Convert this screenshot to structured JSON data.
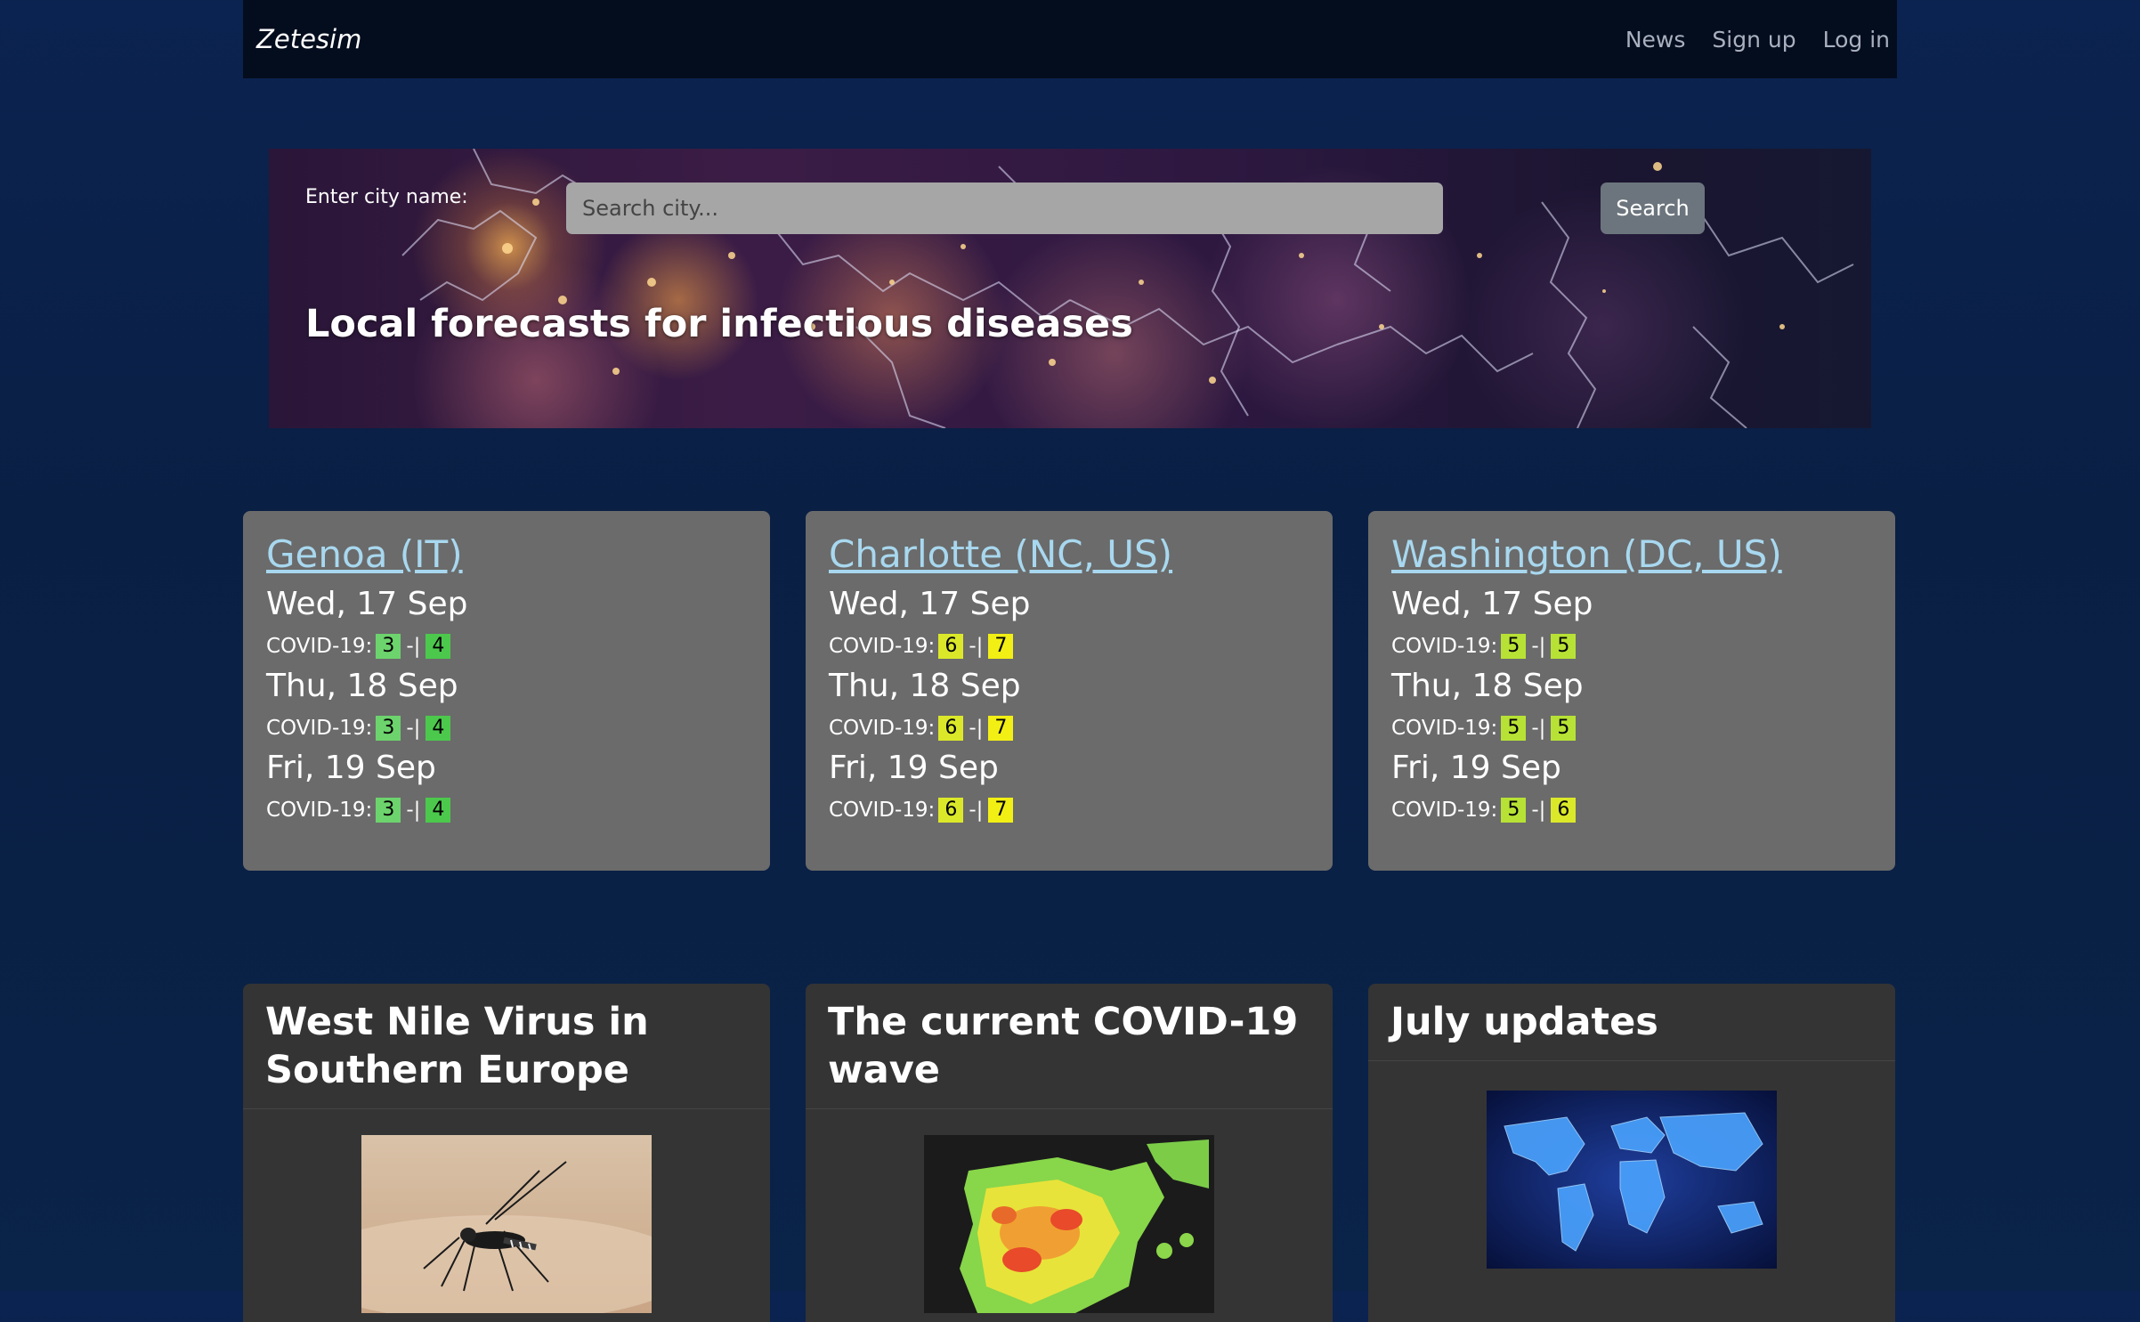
{
  "nav": {
    "brand": "Zetesim",
    "links": [
      "News",
      "Sign up",
      "Log in"
    ]
  },
  "hero": {
    "label": "Enter city name:",
    "search_placeholder": "Search city...",
    "search_button": "Search",
    "title": "Local forecasts for infectious diseases"
  },
  "forecasts": [
    {
      "city": "Genoa (IT)",
      "days": [
        {
          "date": "Wed, 17 Sep",
          "disease": "COVID-19:",
          "low": "3",
          "high": "4"
        },
        {
          "date": "Thu, 18 Sep",
          "disease": "COVID-19:",
          "low": "3",
          "high": "4"
        },
        {
          "date": "Fri, 19 Sep",
          "disease": "COVID-19:",
          "low": "3",
          "high": "4"
        }
      ]
    },
    {
      "city": "Charlotte (NC, US)",
      "days": [
        {
          "date": "Wed, 17 Sep",
          "disease": "COVID-19:",
          "low": "6",
          "high": "7"
        },
        {
          "date": "Thu, 18 Sep",
          "disease": "COVID-19:",
          "low": "6",
          "high": "7"
        },
        {
          "date": "Fri, 19 Sep",
          "disease": "COVID-19:",
          "low": "6",
          "high": "7"
        }
      ]
    },
    {
      "city": "Washington (DC, US)",
      "days": [
        {
          "date": "Wed, 17 Sep",
          "disease": "COVID-19:",
          "low": "5",
          "high": "5"
        },
        {
          "date": "Thu, 18 Sep",
          "disease": "COVID-19:",
          "low": "5",
          "high": "5"
        },
        {
          "date": "Fri, 19 Sep",
          "disease": "COVID-19:",
          "low": "5",
          "high": "6"
        }
      ]
    }
  ],
  "risk_separator": "-|",
  "risk_colors": {
    "3": "#6dd36d",
    "4": "#4cc94c",
    "5": "#b7e235",
    "6": "#dbe82a",
    "7": "#f2ef14"
  },
  "news": [
    {
      "title": "West Nile Virus in Southern Europe",
      "image": "mosquito-photo"
    },
    {
      "title": "The current COVID-19 wave",
      "image": "spain-heatmap"
    },
    {
      "title": "July updates",
      "image": "world-map-glow"
    }
  ]
}
